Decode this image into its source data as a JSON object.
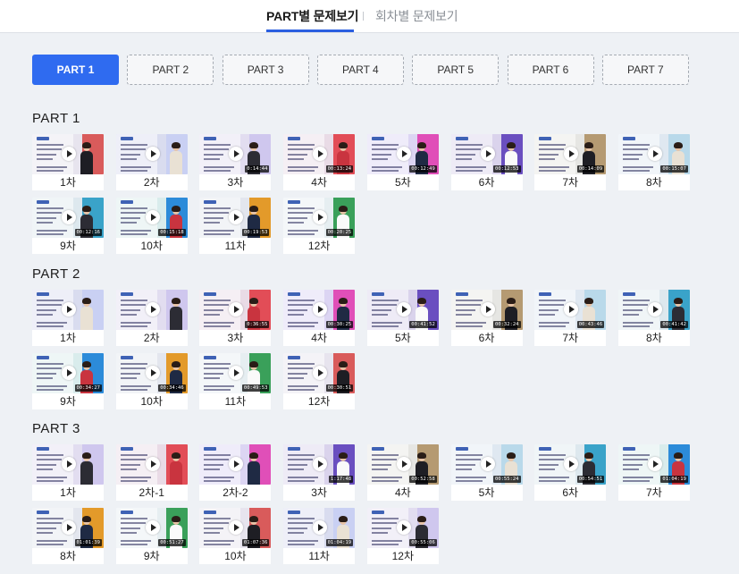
{
  "nav": {
    "tabs": [
      {
        "label": "PART별 문제보기",
        "active": true
      },
      {
        "label": "회차별 문제보기",
        "active": false
      }
    ]
  },
  "part_buttons": [
    "PART 1",
    "PART 2",
    "PART 3",
    "PART 4",
    "PART 5",
    "PART 6",
    "PART 7"
  ],
  "active_part": "PART 1",
  "sections": [
    {
      "title": "PART 1",
      "videos": [
        {
          "label": "1차",
          "duration": ""
        },
        {
          "label": "2차",
          "duration": ""
        },
        {
          "label": "3차",
          "duration": "0:14:44"
        },
        {
          "label": "4차",
          "duration": "00:13:24"
        },
        {
          "label": "5차",
          "duration": "00:12:49"
        },
        {
          "label": "6차",
          "duration": "00:12:53"
        },
        {
          "label": "7차",
          "duration": "00:14:09"
        },
        {
          "label": "8차",
          "duration": "00:15:07"
        },
        {
          "label": "9차",
          "duration": "00:12:16"
        },
        {
          "label": "10차",
          "duration": "00:15:18"
        },
        {
          "label": "11차",
          "duration": "00:19:53"
        },
        {
          "label": "12차",
          "duration": "00:20:25"
        }
      ]
    },
    {
      "title": "PART 2",
      "videos": [
        {
          "label": "1차",
          "duration": ""
        },
        {
          "label": "2차",
          "duration": ""
        },
        {
          "label": "3차",
          "duration": "0:36:55"
        },
        {
          "label": "4차",
          "duration": "00:30:25"
        },
        {
          "label": "5차",
          "duration": "00:41:52"
        },
        {
          "label": "6차",
          "duration": "00:32:24"
        },
        {
          "label": "7차",
          "duration": "00:43:46"
        },
        {
          "label": "8차",
          "duration": "00:41:42"
        },
        {
          "label": "9차",
          "duration": "00:34:27"
        },
        {
          "label": "10차",
          "duration": "00:34:46"
        },
        {
          "label": "11차",
          "duration": "00:49:53"
        },
        {
          "label": "12차",
          "duration": "00:30:51"
        }
      ]
    },
    {
      "title": "PART 3",
      "videos": [
        {
          "label": "1차",
          "duration": ""
        },
        {
          "label": "2차-1",
          "duration": ""
        },
        {
          "label": "2차-2",
          "duration": ""
        },
        {
          "label": "3차",
          "duration": "1:17:48"
        },
        {
          "label": "4차",
          "duration": "00:52:58"
        },
        {
          "label": "5차",
          "duration": "00:55:24"
        },
        {
          "label": "6차",
          "duration": "00:54:51"
        },
        {
          "label": "7차",
          "duration": "01:04:19"
        },
        {
          "label": "8차",
          "duration": "01:01:39"
        },
        {
          "label": "9차",
          "duration": "00:51:27"
        },
        {
          "label": "10차",
          "duration": "01:07:36"
        },
        {
          "label": "11차",
          "duration": "01:04:19"
        },
        {
          "label": "12차",
          "duration": "00:55:06"
        }
      ]
    }
  ],
  "colors": {
    "accent": "#2f6bf0",
    "thumb_backgrounds": [
      "#e7e4ee",
      "#d9dcef",
      "#e2ddf0",
      "#e9dbe6",
      "#dcd5f3",
      "#dad3ec",
      "#e6e6e3",
      "#dfe8f1",
      "#dde8ee",
      "#d9ecec",
      "#e3e6ee",
      "#e6eef1"
    ],
    "thumb_accents": [
      "#d95b5b",
      "#c9d0f3",
      "#cfc7ee",
      "#e24d57",
      "#e04fb8",
      "#6a4fc0",
      "#b59a72",
      "#b9d9ea",
      "#3aa3c9",
      "#2c8bd9",
      "#e39a2a",
      "#3aa05a"
    ]
  }
}
